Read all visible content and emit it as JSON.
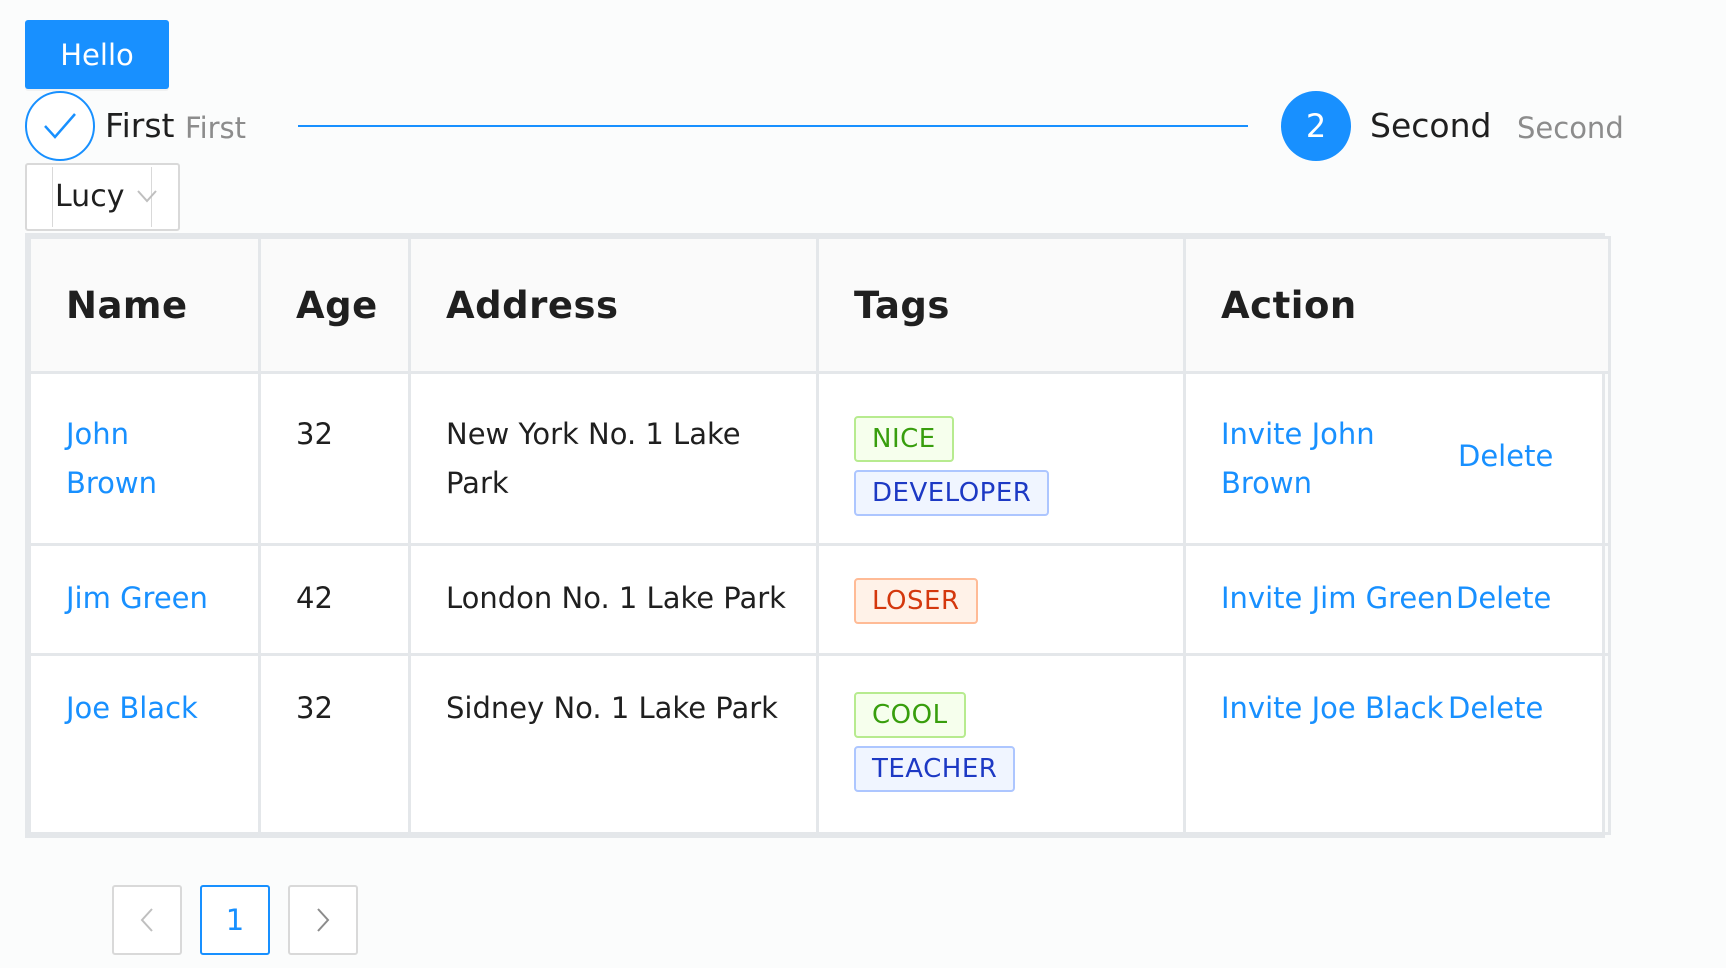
{
  "button": {
    "label": "Hello"
  },
  "steps": [
    {
      "title": "First",
      "description": "First",
      "status": "finish"
    },
    {
      "number": "2",
      "title": "Second",
      "description": "Second",
      "status": "process"
    }
  ],
  "select": {
    "value": "Lucy"
  },
  "table": {
    "columns": [
      "Name",
      "Age",
      "Address",
      "Tags",
      "Action"
    ],
    "rows": [
      {
        "name": "John Brown",
        "age": "32",
        "address": "New York No. 1 Lake Park",
        "tags": [
          "NICE",
          "DEVELOPER"
        ],
        "invite": "Invite John Brown",
        "delete": "Delete"
      },
      {
        "name": "Jim Green",
        "age": "42",
        "address": "London No. 1 Lake Park",
        "tags": [
          "LOSER"
        ],
        "invite": "Invite Jim Green",
        "delete": "Delete"
      },
      {
        "name": "Joe Black",
        "age": "32",
        "address": "Sidney No. 1 Lake Park",
        "tags": [
          "COOL",
          "TEACHER"
        ],
        "invite": "Invite Joe Black",
        "delete": "Delete"
      }
    ]
  },
  "pagination": {
    "current_page": "1"
  },
  "colors": {
    "primary": "#1890ff",
    "tag_green": "#389e0d",
    "tag_blue": "#1d39c4",
    "tag_volcano": "#d4380d"
  }
}
